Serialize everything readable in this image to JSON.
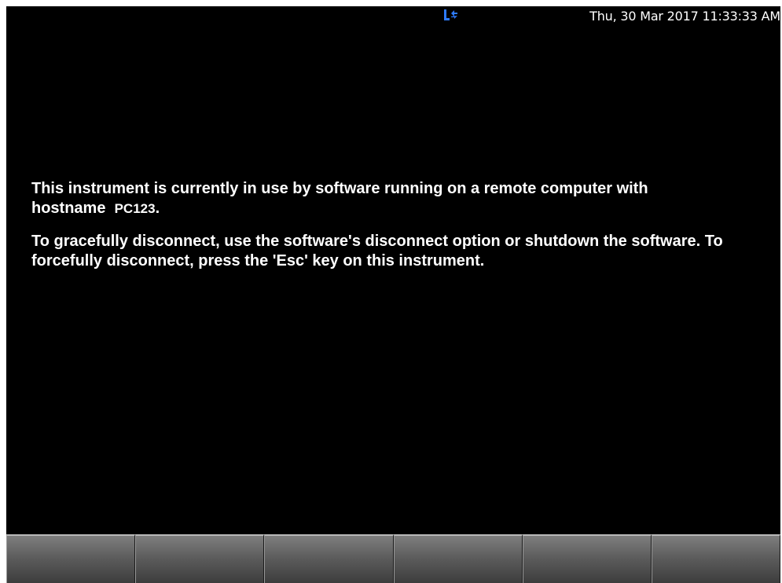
{
  "status_bar": {
    "remote_icon": "remote-connection-icon",
    "datetime": "Thu, 30 Mar 2017 11:33:33 AM"
  },
  "message": {
    "line1_prefix": "This instrument is currently in use by software running on a remote computer with hostname",
    "hostname": "PC123",
    "line1_suffix": ".",
    "paragraph2": "To gracefully disconnect, use the software's disconnect option or shutdown the software. To forcefully disconnect, press the 'Esc' key on this instrument."
  },
  "softkeys": [
    "",
    "",
    "",
    "",
    "",
    ""
  ],
  "colors": {
    "background": "#000000",
    "text": "#ffffff",
    "icon_accent": "#2e7bff"
  }
}
